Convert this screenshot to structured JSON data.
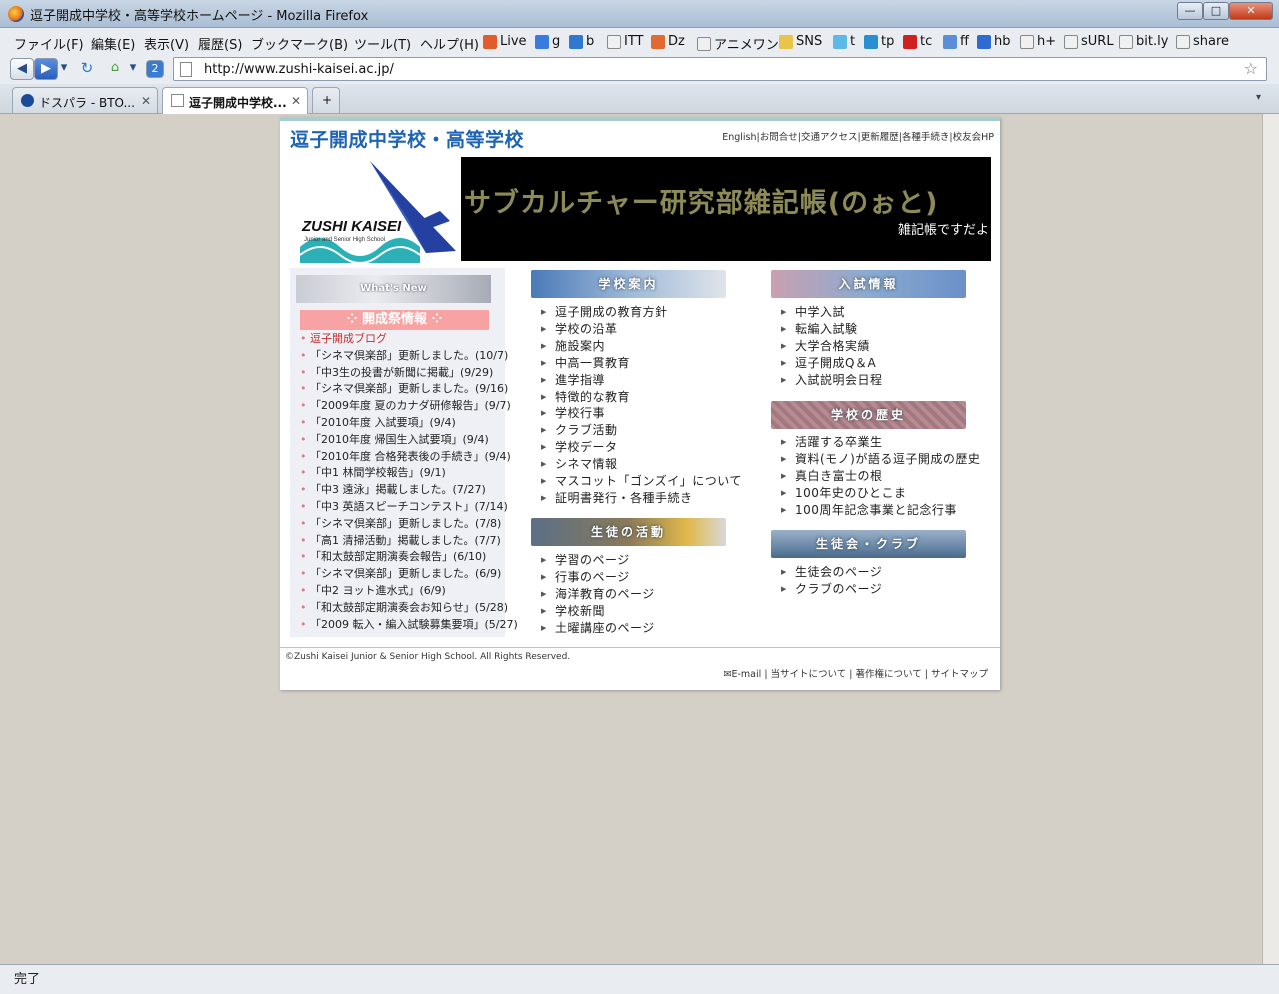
{
  "window": {
    "title": "逗子開成中学校・高等学校ホームページ - Mozilla Firefox"
  },
  "menu": [
    "ファイル(F)",
    "編集(E)",
    "表示(V)",
    "履歴(S)",
    "ブックマーク(B)",
    "ツール(T)",
    "ヘルプ(H)"
  ],
  "bookmarks": [
    {
      "label": "Live",
      "color": "#e25b2a"
    },
    {
      "label": "g",
      "color": "#3a7be0"
    },
    {
      "label": "b",
      "color": "#2f7ad0"
    },
    {
      "label": "ITT",
      "color": "#f0f0f0"
    },
    {
      "label": "Dz",
      "color": "#e06a30"
    },
    {
      "label": "アニメワン",
      "color": "#f0f0f0"
    },
    {
      "label": "SNS",
      "color": "#e8c44a"
    },
    {
      "label": "t",
      "color": "#5cb8e6"
    },
    {
      "label": "tp",
      "color": "#2a8fd0"
    },
    {
      "label": "tc",
      "color": "#d02020"
    },
    {
      "label": "ff",
      "color": "#5a8fd8"
    },
    {
      "label": "hb",
      "color": "#2e6ad0"
    },
    {
      "label": "h+",
      "color": "#f0f0f0"
    },
    {
      "label": "sURL",
      "color": "#f0f0f0"
    },
    {
      "label": "bit.ly",
      "color": "#f0f0f0"
    },
    {
      "label": "share",
      "color": "#f0f0f0"
    }
  ],
  "address": {
    "url": "http://www.zushi-kaisei.ac.jp/"
  },
  "tabs": [
    {
      "label": "ドスパラ - BTO...",
      "active": false
    },
    {
      "label": "逗子開成中学校...",
      "active": true
    }
  ],
  "status": "完了",
  "site": {
    "title": "逗子開成中学校・高等学校",
    "toplinks": [
      "English",
      "お問合せ",
      "交通アクセス",
      "更新履歴",
      "各種手続き",
      "校友会HP"
    ],
    "logo": {
      "name": "ZUSHI KAISEI",
      "sub": "Junior and Senior High School"
    },
    "banner": {
      "title": "サブカルチャー研究部雑記帳(のぉと)",
      "subtitle": "雑記帳ですだよ"
    }
  },
  "news": {
    "header": "What's New",
    "festival": "開成祭情報",
    "items": [
      "逗子開成ブログ",
      "「シネマ倶楽部」更新しました。(10/7)",
      "「中3生の投書が新聞に掲載」(9/29)",
      "「シネマ倶楽部」更新しました。(9/16)",
      "「2009年度 夏のカナダ研修報告」(9/7)",
      "「2010年度 入試要項」(9/4)",
      "「2010年度 帰国生入試要項」(9/4)",
      "「2010年度 合格発表後の手続き」(9/4)",
      "「中1 林間学校報告」(9/1)",
      "「中3 遠泳」掲載しました。(7/27)",
      "「中3 英語スピーチコンテスト」(7/14)",
      "「シネマ倶楽部」更新しました。(7/8)",
      "「高1 清掃活動」掲載しました。(7/7)",
      "「和太鼓部定期演奏会報告」(6/10)",
      "「シネマ倶楽部」更新しました。(6/9)",
      "「中2 ヨット進水式」(6/9)",
      "「和太鼓部定期演奏会お知らせ」(5/28)",
      "「2009 転入・編入試験募集要項」(5/27)"
    ]
  },
  "sections": {
    "about": {
      "header": "学校案内",
      "items": [
        "逗子開成の教育方針",
        "学校の沿革",
        "施設案内",
        "中高一貫教育",
        "進学指導",
        "特徴的な教育",
        "学校行事",
        "クラブ活動",
        "学校データ",
        "シネマ情報",
        "マスコット「ゴンズイ」について",
        "証明書発行・各種手続き"
      ]
    },
    "students": {
      "header": "生徒の活動",
      "items": [
        "学習のページ",
        "行事のページ",
        "海洋教育のページ",
        "学校新聞",
        "土曜講座のページ"
      ]
    },
    "admission": {
      "header": "入試情報",
      "items": [
        "中学入試",
        "転編入試験",
        "大学合格実績",
        "逗子開成Q＆A",
        "入試説明会日程"
      ]
    },
    "history": {
      "header": "学校の歴史",
      "items": [
        "活躍する卒業生",
        "資料(モノ)が語る逗子開成の歴史",
        "真白き富士の根",
        "100年史のひとこま",
        "100周年記念事業と記念行事"
      ]
    },
    "council": {
      "header": "生徒会・クラブ",
      "items": [
        "生徒会のページ",
        "クラブのページ"
      ]
    }
  },
  "footer": {
    "copyright": "©Zushi Kaisei Junior & Senior High School. All Rights Reserved.",
    "links": [
      "E-mail",
      "当サイトについて",
      "著作権について",
      "サイトマップ"
    ]
  }
}
